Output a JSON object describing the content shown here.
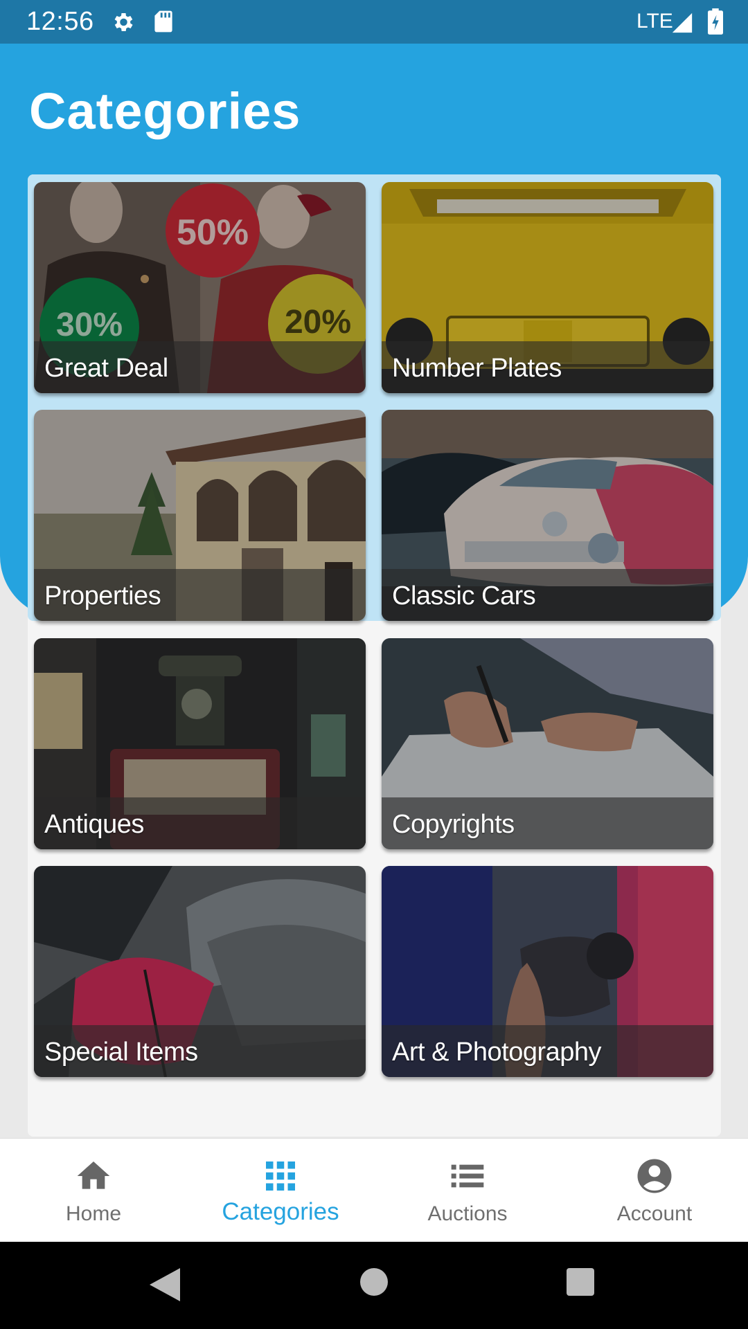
{
  "status_bar": {
    "time": "12:56",
    "network": "LTE",
    "icons": [
      "gear-icon",
      "sd-card-icon",
      "signal-icon",
      "battery-icon"
    ]
  },
  "page": {
    "title": "Categories"
  },
  "categories": [
    {
      "label": "Great Deal",
      "badges": [
        "50%",
        "30%",
        "20%"
      ]
    },
    {
      "label": "Number Plates"
    },
    {
      "label": "Properties"
    },
    {
      "label": "Classic Cars"
    },
    {
      "label": "Antiques"
    },
    {
      "label": "Copyrights"
    },
    {
      "label": "Special Items"
    },
    {
      "label": "Art & Photography"
    }
  ],
  "bottom_nav": {
    "items": [
      {
        "label": "Home",
        "icon": "home-icon",
        "active": false
      },
      {
        "label": "Categories",
        "icon": "grid-icon",
        "active": true
      },
      {
        "label": "Auctions",
        "icon": "list-icon",
        "active": false
      },
      {
        "label": "Account",
        "icon": "account-icon",
        "active": false
      }
    ]
  },
  "colors": {
    "header_blue": "#25a3df",
    "status_bar": "#1e77a6",
    "active_nav": "#25a3df",
    "inactive_nav": "#6f6f6f"
  }
}
